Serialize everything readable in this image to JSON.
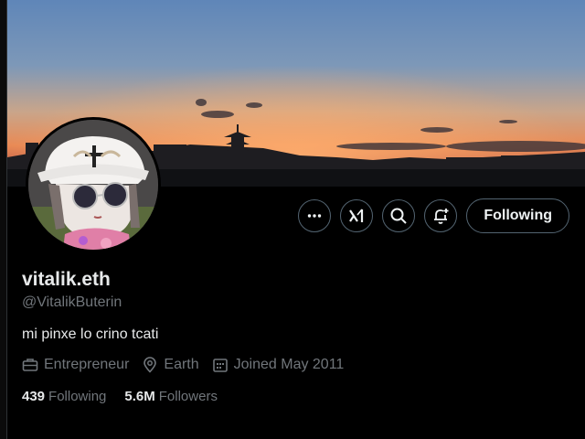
{
  "profile": {
    "display_name": "vitalik.eth",
    "handle": "@VitalikButerin",
    "bio": "mi pinxe lo crino tcati",
    "profession": "Entrepreneur",
    "location": "Earth",
    "joined": "Joined May 2011",
    "following_count": "439",
    "following_label": "Following",
    "followers_count": "5.6M",
    "followers_label": "Followers"
  },
  "actions": {
    "more_icon": "more-horizontal-icon",
    "grok_icon": "grok-icon",
    "search_icon": "search-icon",
    "notify_icon": "bell-plus-icon",
    "follow_label": "Following"
  },
  "meta_icons": {
    "profession": "briefcase-icon",
    "location": "location-pin-icon",
    "joined": "calendar-icon"
  },
  "colors": {
    "background": "#000000",
    "primary_text": "#e7e9ea",
    "secondary_text": "#71767b",
    "button_border": "#536471"
  }
}
